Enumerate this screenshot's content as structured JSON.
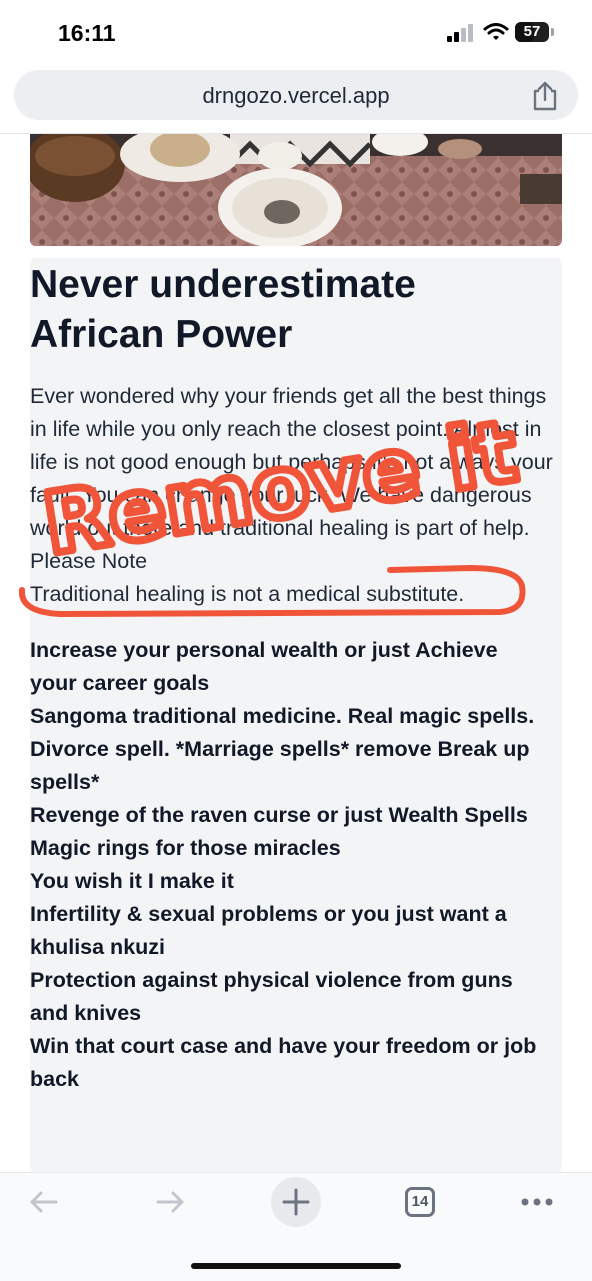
{
  "status_bar": {
    "time": "16:11",
    "battery": "57",
    "battery_level_percent": 57
  },
  "browser": {
    "url": "drngozo.vercel.app",
    "tab_count": "14"
  },
  "article": {
    "heading": "Never underestimate African Power",
    "paragraph": "Ever wondered why your friends get all the best things in life while you only reach the closest point. Almost in life is not good enough but perhaps it's not always your fault. You can change your luck. We have dangerous world out there and traditional healing is part of help. Please Note",
    "paragraph_last_line": "Traditional healing is not a medical substitute.",
    "services": [
      "Increase your personal wealth or just Achieve your career goals",
      "Sangoma traditional medicine. Real magic spells.",
      "Divorce spell. *Marriage spells* remove Break up spells*",
      "Revenge of the raven curse or just Wealth Spells",
      "Magic rings for those miracles",
      "You wish it I make it",
      "Infertility & sexual problems or you just want a khulisa nkuzi",
      "Protection against physical violence from guns and knives",
      "Win that court case and have your freedom or job back"
    ]
  },
  "annotation": {
    "text": "Remove it",
    "color": "#f0553a"
  },
  "icons": [
    "signal-icon",
    "wifi-icon",
    "battery-icon",
    "share-icon",
    "back-icon",
    "forward-icon",
    "plus-icon",
    "tabs-icon",
    "more-icon"
  ]
}
